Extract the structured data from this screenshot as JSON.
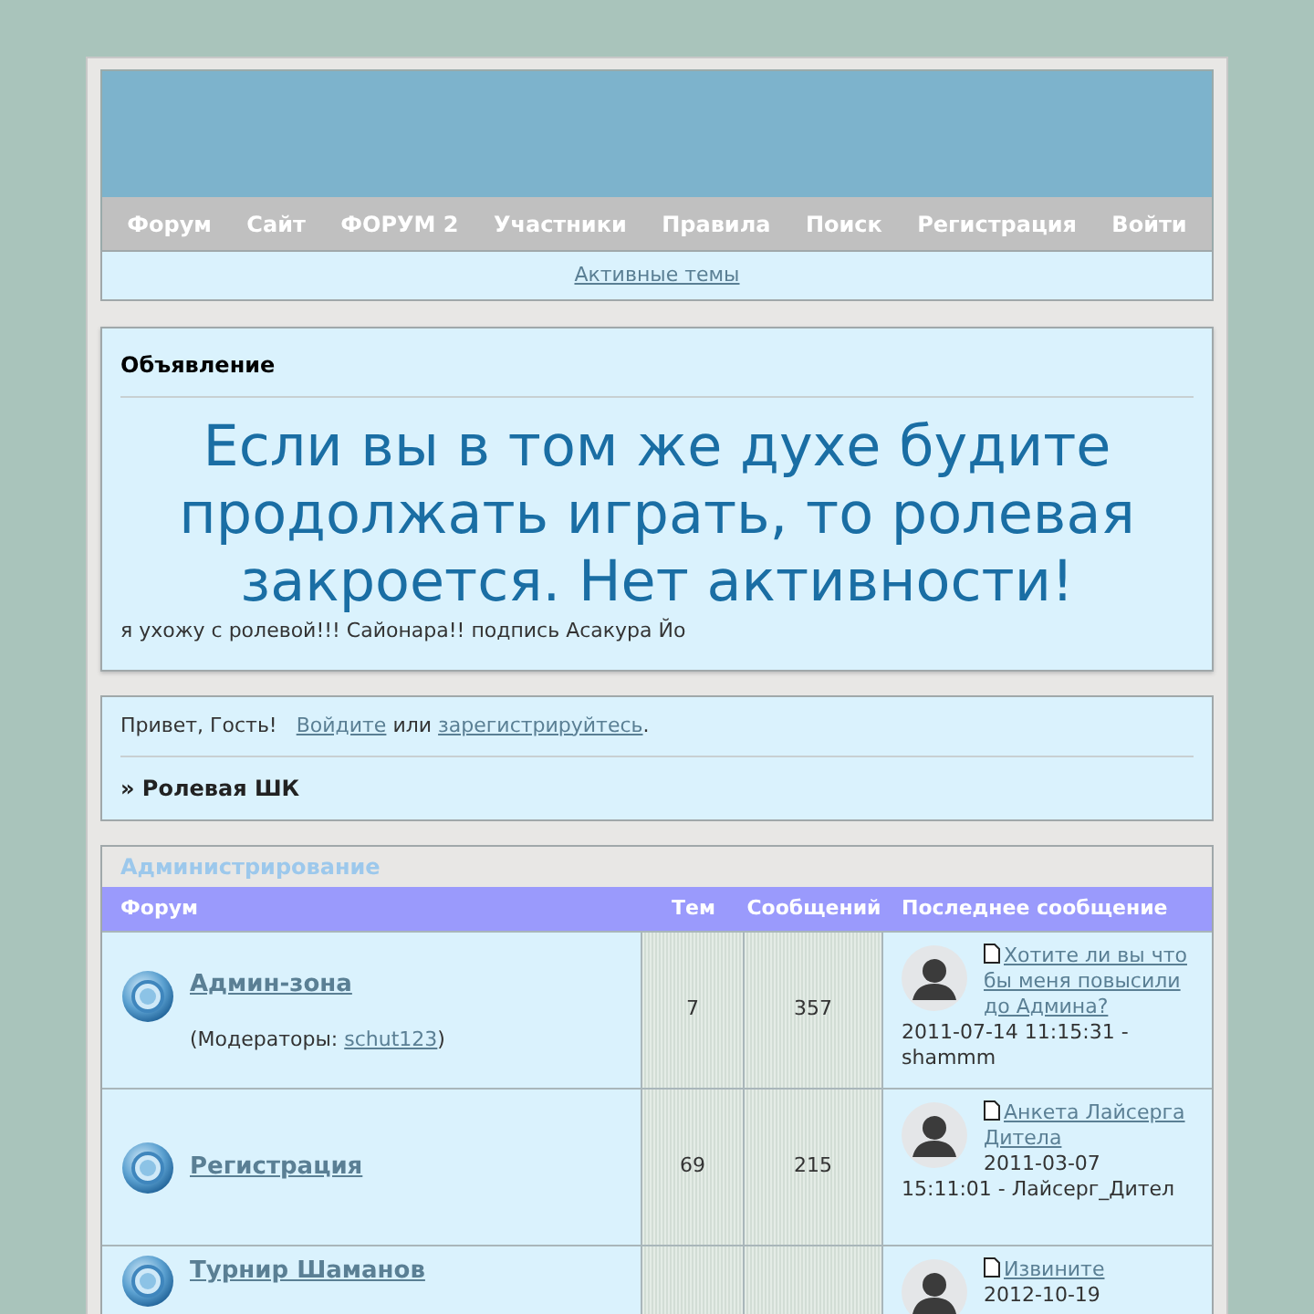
{
  "nav": [
    "Форум",
    "Сайт",
    "ФОРУМ 2",
    "Участники",
    "Правила",
    "Поиск",
    "Регистрация",
    "Войти"
  ],
  "subnav": {
    "link": "Активные темы"
  },
  "announcement": {
    "title": "Объявление",
    "headline": "Если вы в том же духе будите продолжать играть, то ролевая закроется. Нет активности!",
    "note": "я ухожу с ролевой!!! Сайонара!! подпись Асакура Йо"
  },
  "welcome": {
    "greeting": "Привет, Гость!",
    "login": "Войдите",
    "or": "или",
    "register": "зарегистрируйтесь",
    "end": ".",
    "breadcrumb": "» Ролевая ШК"
  },
  "category": {
    "title": "Администрирование",
    "columns": [
      "Форум",
      "Тем",
      "Сообщений",
      "Последнее сообщение"
    ],
    "forums": [
      {
        "title": "Админ-зона",
        "moderators_label": "(Модераторы:",
        "moderator": "schut123",
        "moderators_end": ")",
        "topics": "7",
        "posts": "357",
        "last_title": "Хотите ли вы что бы меня повысили до Админа?",
        "last_meta": "2011-07-14 11:15:31 - shammm"
      },
      {
        "title": "Регистрация",
        "topics": "69",
        "posts": "215",
        "last_title": "Анкета Лайсерга Дитела",
        "last_meta": "2011-03-07 15:11:01 - Лайсерг_Дител"
      },
      {
        "title": "Турнир Шаманов",
        "last_title": "Извините",
        "last_meta": "2012-10-19"
      }
    ]
  }
}
